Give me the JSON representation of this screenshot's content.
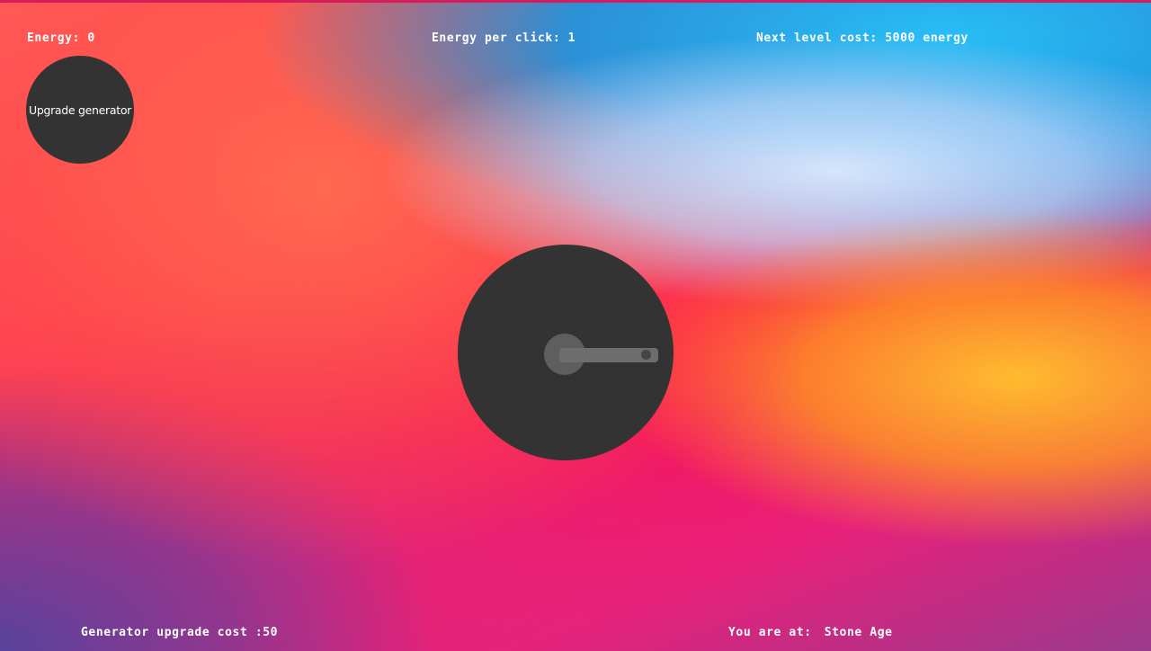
{
  "stats": {
    "energy": "Energy: 0",
    "energy_per_click": "Energy per click: 1",
    "next_level_cost": "Next level cost: 5000 energy",
    "generator_upgrade_cost": "Generator upgrade cost :50",
    "location_label": "You are at:",
    "era": "Stone Age"
  },
  "buttons": {
    "upgrade_generator": "Upgrade generator"
  },
  "generator": {
    "icon": "crank-icon"
  },
  "colors": {
    "button_bg": "#333333",
    "text": "#ffffff"
  }
}
